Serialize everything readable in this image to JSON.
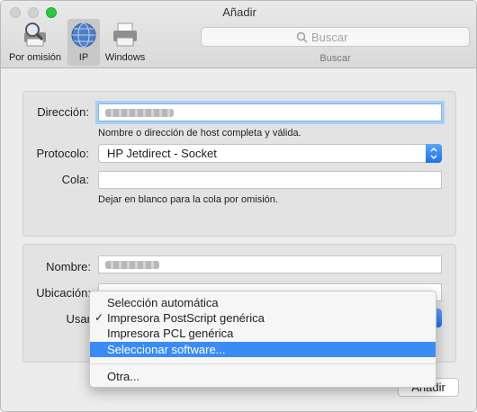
{
  "window": {
    "title": "Añadir"
  },
  "toolbar": {
    "default_label": "Por omisión",
    "ip_label": "IP",
    "windows_label": "Windows",
    "search_placeholder": "Buscar",
    "search_caption": "Buscar"
  },
  "form": {
    "address_label": "Dirección:",
    "address_hint": "Nombre o dirección de host completa y válida.",
    "protocol_label": "Protocolo:",
    "protocol_value": "HP Jetdirect - Socket",
    "queue_label": "Cola:",
    "queue_value": "",
    "queue_hint": "Dejar en blanco para la cola por omisión.",
    "name_label": "Nombre:",
    "location_label": "Ubicación:",
    "use_label": "Usar"
  },
  "menu": {
    "items": [
      {
        "label": "Selección automática",
        "checked": false
      },
      {
        "label": "Impresora PostScript genérica",
        "checked": true
      },
      {
        "label": "Impresora PCL genérica",
        "checked": false
      },
      {
        "label": "Seleccionar software...",
        "checked": false,
        "highlighted": true
      },
      {
        "label": "Otra...",
        "checked": false
      }
    ],
    "check_glyph": "✓"
  },
  "buttons": {
    "add_label": "Añadir"
  },
  "colors": {
    "accent": "#3a8bf6",
    "zoom_button": "#2bc840"
  }
}
